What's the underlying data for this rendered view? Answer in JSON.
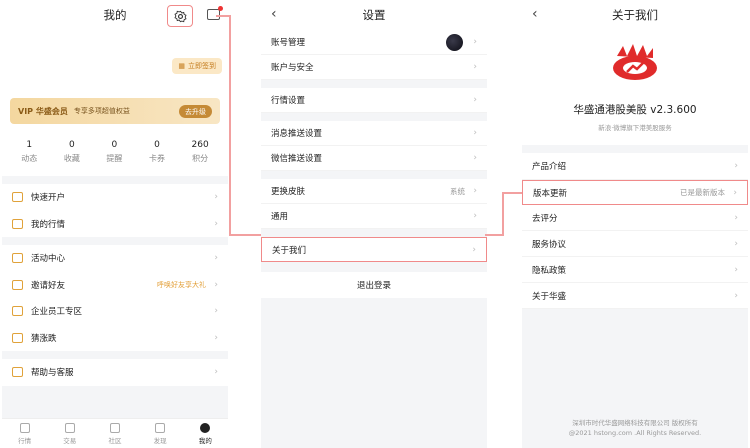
{
  "screen1": {
    "title": "我的",
    "checkin_label": "立即签到",
    "vip": {
      "badge": "VIP 华盛会员",
      "desc": "专享多项超值权益",
      "button": "去升级"
    },
    "stats": [
      {
        "value": "1",
        "label": "动态"
      },
      {
        "value": "0",
        "label": "收藏"
      },
      {
        "value": "0",
        "label": "提醒"
      },
      {
        "value": "0",
        "label": "卡券"
      },
      {
        "value": "260",
        "label": "积分"
      }
    ],
    "menu_group1": [
      {
        "label": "快速开户"
      },
      {
        "label": "我的行情"
      }
    ],
    "menu_group2": [
      {
        "label": "活动中心",
        "extra": ""
      },
      {
        "label": "邀请好友",
        "extra": "呼唤好友享大礼"
      },
      {
        "label": "企业员工专区",
        "extra": ""
      },
      {
        "label": "猜涨跌",
        "extra": ""
      }
    ],
    "menu_group3": [
      {
        "label": "帮助与客服"
      }
    ],
    "tabs": [
      "行情",
      "交易",
      "社区",
      "发现",
      "我的"
    ]
  },
  "screen2": {
    "title": "设置",
    "rows_a": [
      {
        "label": "账号管理",
        "extra": ""
      },
      {
        "label": "账户与安全",
        "extra": ""
      }
    ],
    "rows_b": [
      {
        "label": "行情设置",
        "extra": ""
      }
    ],
    "rows_c": [
      {
        "label": "消息推送设置",
        "extra": ""
      },
      {
        "label": "微信推送设置",
        "extra": ""
      }
    ],
    "rows_d": [
      {
        "label": "更换皮肤",
        "extra": "系统"
      },
      {
        "label": "通用",
        "extra": ""
      }
    ],
    "about": "关于我们",
    "logout": "退出登录"
  },
  "screen3": {
    "title": "关于我们",
    "version": "华盛通港股美股 v2.3.600",
    "subtitle": "新浪·微博旗下港美股服务",
    "rows": [
      {
        "label": "产品介绍",
        "extra": ""
      },
      {
        "label": "版本更新",
        "extra": "已是最新版本"
      },
      {
        "label": "去评分",
        "extra": ""
      },
      {
        "label": "服务协议",
        "extra": ""
      },
      {
        "label": "隐私政策",
        "extra": ""
      },
      {
        "label": "关于华盛",
        "extra": ""
      }
    ],
    "footer1": "深圳市时代华盛网络科技有限公司 版权所有",
    "footer2": "@2021 hstong.com .All Rights Reserved."
  },
  "colors": {
    "accent_gold": "#e0a23a",
    "highlight": "#f08a8a",
    "brand_red": "#e02b2b"
  }
}
